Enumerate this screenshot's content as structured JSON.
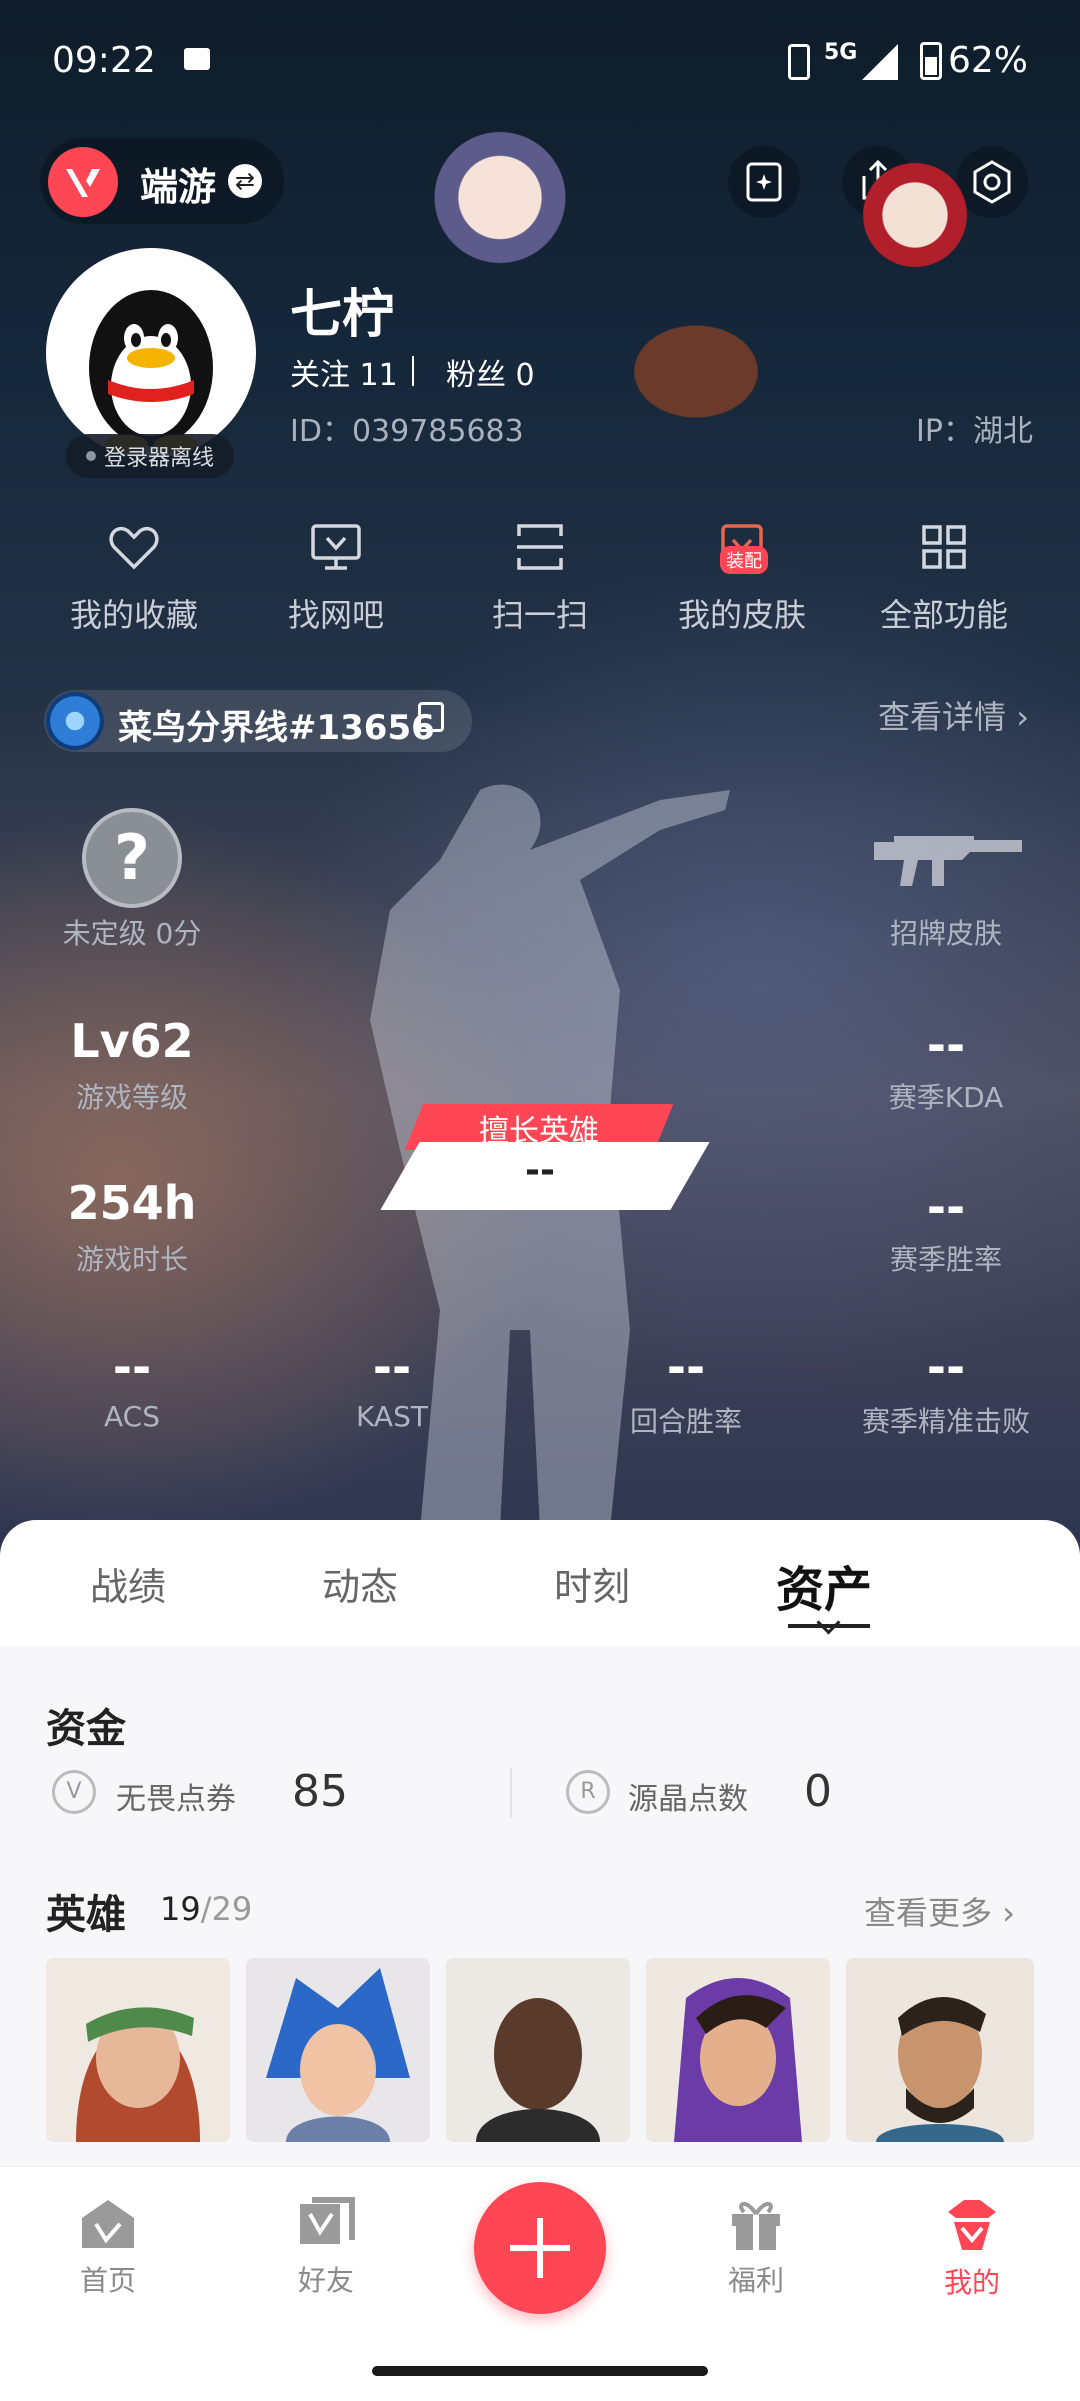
{
  "status_bar": {
    "time": "09:22",
    "network": "5G",
    "battery": "62%"
  },
  "header": {
    "app_name": "端游"
  },
  "profile": {
    "name": "七柠",
    "follow_label": "关注",
    "follow_count": "11",
    "fans_label": "粉丝",
    "fans_count": "0",
    "id_text": "ID：039785683",
    "ip_text": "IP：湖北",
    "offline_text": "登录器离线"
  },
  "shortcuts": [
    {
      "label": "我的收藏",
      "icon": "heart-icon"
    },
    {
      "label": "找网吧",
      "icon": "monitor-icon"
    },
    {
      "label": "扫一扫",
      "icon": "scan-icon"
    },
    {
      "label": "我的皮肤",
      "icon": "skin-icon",
      "badge": "装配"
    },
    {
      "label": "全部功能",
      "icon": "grid-icon"
    }
  ],
  "game_account": {
    "name": "菜鸟分界线#13656",
    "details_link": "查看详情"
  },
  "stats": {
    "rank": "未定级 0分",
    "signature_skin": "招牌皮肤",
    "level_value": "Lv62",
    "level_label": "游戏等级",
    "playtime_value": "254h",
    "playtime_label": "游戏时长",
    "kda_value": "--",
    "kda_label": "赛季KDA",
    "winrate_value": "--",
    "winrate_label": "赛季胜率",
    "best_hero_label": "擅长英雄",
    "best_hero_value": "--",
    "bottom": [
      {
        "value": "--",
        "label": "ACS"
      },
      {
        "value": "--",
        "label": "KAST"
      },
      {
        "value": "--",
        "label": "回合胜率"
      },
      {
        "value": "--",
        "label": "赛季精准击败"
      }
    ]
  },
  "tabs": [
    "战绩",
    "动态",
    "时刻",
    "资产"
  ],
  "active_tab": "资产",
  "funds": {
    "title": "资金",
    "vp_label": "无畏点券",
    "vp_value": "85",
    "rp_label": "源晶点数",
    "rp_value": "0"
  },
  "heroes": {
    "title": "英雄",
    "owned": "19",
    "sep": "/",
    "total": "29",
    "more_link": "查看更多"
  },
  "bottom_nav": [
    {
      "label": "首页"
    },
    {
      "label": "好友"
    },
    {
      "label": "福利"
    },
    {
      "label": "我的"
    }
  ],
  "colors": {
    "accent": "#ff4655",
    "active_nav": "#ff4655"
  }
}
